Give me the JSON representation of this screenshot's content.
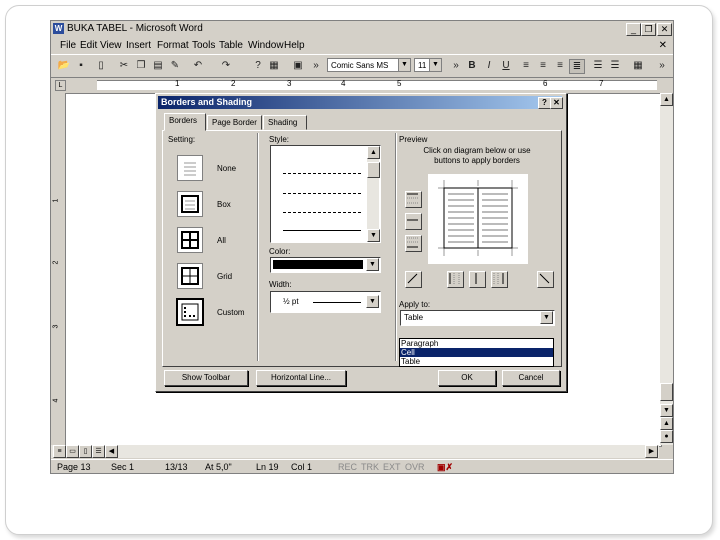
{
  "window": {
    "title": "BUKA TABEL - Microsoft Word",
    "min": "_",
    "max": "❐",
    "close": "✕"
  },
  "menu": [
    "File",
    "Edit",
    "View",
    "Insert",
    "Format",
    "Tools",
    "Table",
    "Window",
    "Help"
  ],
  "menu_close": "✕",
  "toolbar": {
    "font": "Comic Sans MS",
    "size": "11",
    "bold": "B",
    "italic": "I",
    "underline": "U"
  },
  "ruler_numbers": [
    "1",
    "2",
    "3",
    "4",
    "5",
    "6",
    "7"
  ],
  "vruler_numbers": [
    "1",
    "2",
    "3",
    "4"
  ],
  "dialog": {
    "title": "Borders and Shading",
    "help_btn": "?",
    "close_btn": "✕",
    "tabs": [
      "Borders",
      "Page Border",
      "Shading"
    ],
    "setting_label": "Setting:",
    "settings": [
      "None",
      "Box",
      "All",
      "Grid",
      "Custom"
    ],
    "style_label": "Style:",
    "color_label": "Color:",
    "width_label": "Width:",
    "width_value": "½ pt",
    "preview_label": "Preview",
    "preview_text": "Click on diagram below or use buttons to apply borders",
    "apply_label": "Apply to:",
    "apply_value": "Table",
    "apply_options": [
      "Paragraph",
      "Cell",
      "Table"
    ],
    "apply_selected_index": 1,
    "buttons": {
      "show_toolbar": "Show Toolbar",
      "horizontal_line": "Horizontal Line...",
      "ok": "OK",
      "cancel": "Cancel"
    }
  },
  "status": {
    "page": "Page 13",
    "sec": "Sec 1",
    "pages": "13/13",
    "at": "At 5,0\"",
    "ln": "Ln 19",
    "col": "Col 1",
    "rec": "REC",
    "trk": "TRK",
    "ext": "EXT",
    "ovr": "OVR"
  }
}
